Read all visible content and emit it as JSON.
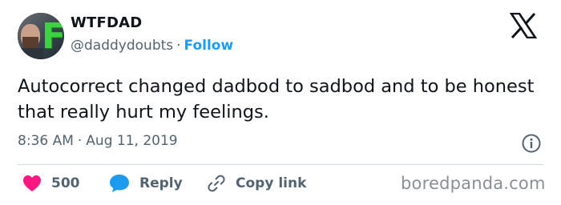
{
  "author": {
    "display_name": "WTFDAD",
    "handle": "@daddydoubts",
    "separator": "·",
    "follow_label": "Follow"
  },
  "tweet": {
    "text": "Autocorrect changed dadbod to sadbod and to be honest that really hurt my feelings.",
    "time": "8:36 AM",
    "date": "Aug 11, 2019",
    "separator": "·"
  },
  "actions": {
    "like_count": "500",
    "reply_label": "Reply",
    "copy_link_label": "Copy link"
  },
  "watermark": "boredpanda.com",
  "icons": {
    "platform": "x-logo-icon",
    "info": "info-icon",
    "like": "heart-icon",
    "reply": "speech-bubble-icon",
    "copy_link": "link-icon"
  },
  "colors": {
    "follow": "#1d9bf0",
    "heart": "#f91880",
    "reply_bubble": "#1d9bf0",
    "secondary_text": "#536471",
    "primary_text": "#0f1419",
    "avatar_letter": "#3dd23f"
  }
}
